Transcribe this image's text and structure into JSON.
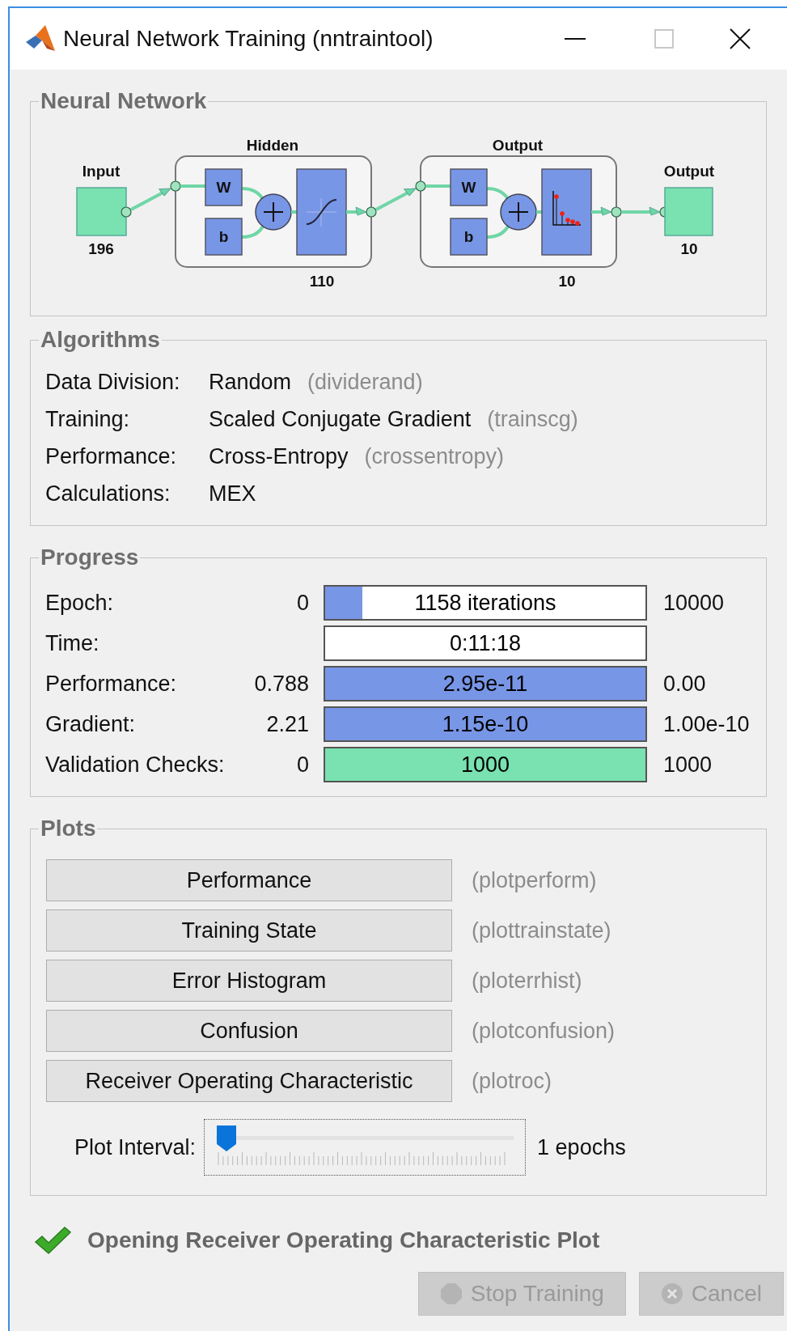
{
  "window": {
    "title": "Neural Network Training (nntraintool)"
  },
  "network": {
    "title": "Neural Network",
    "input": {
      "label": "Input",
      "size": "196"
    },
    "layers": [
      {
        "name": "Hidden",
        "weight": "W",
        "bias": "b",
        "size": "110",
        "kind": "sigmoid"
      },
      {
        "name": "Output",
        "weight": "W",
        "bias": "b",
        "size": "10",
        "kind": "softmax"
      }
    ],
    "output": {
      "label": "Output",
      "size": "10"
    }
  },
  "algorithms": {
    "title": "Algorithms",
    "rows": [
      {
        "label": "Data Division:",
        "value": "Random",
        "function": "(dividerand)"
      },
      {
        "label": "Training:",
        "value": "Scaled Conjugate Gradient",
        "function": "(trainscg)"
      },
      {
        "label": "Performance:",
        "value": "Cross-Entropy",
        "function": "(crossentropy)"
      },
      {
        "label": "Calculations:",
        "value": "MEX"
      }
    ]
  },
  "progress": {
    "title": "Progress",
    "rows": [
      {
        "label": "Epoch:",
        "start": "0",
        "bar": "1158 iterations",
        "end": "10000",
        "level": 0.116,
        "color": "#7896e6"
      },
      {
        "label": "Time:",
        "bar": "0:11:18"
      },
      {
        "label": "Performance:",
        "start": "0.788",
        "bar": "2.95e-11",
        "end": "0.00",
        "level": 1,
        "color": "#7896e6"
      },
      {
        "label": "Gradient:",
        "start": "2.21",
        "bar": "1.15e-10",
        "end": "1.00e-10",
        "level": 1,
        "color": "#7896e6"
      },
      {
        "label": "Validation Checks:",
        "start": "0",
        "bar": "1000",
        "end": "1000",
        "level": 1,
        "color": "#79e2b0"
      }
    ]
  },
  "plots": {
    "title": "Plots",
    "buttons": [
      {
        "label": "Performance",
        "function": "(plotperform)"
      },
      {
        "label": "Training State",
        "function": "(plottrainstate)"
      },
      {
        "label": "Error Histogram",
        "function": "(ploterrhist)"
      },
      {
        "label": "Confusion",
        "function": "(plotconfusion)"
      },
      {
        "label": "Receiver Operating Characteristic",
        "function": "(plotroc)"
      }
    ],
    "interval": {
      "label": "Plot Interval:",
      "level": 0,
      "reading": "1 epochs"
    }
  },
  "status": {
    "kind": "success",
    "text": "Opening Receiver Operating Characteristic Plot"
  },
  "actions": [
    {
      "kind": "stop",
      "label": "Stop Training",
      "disabled": true
    },
    {
      "kind": "cancel",
      "label": "Cancel",
      "disabled": true
    }
  ]
}
